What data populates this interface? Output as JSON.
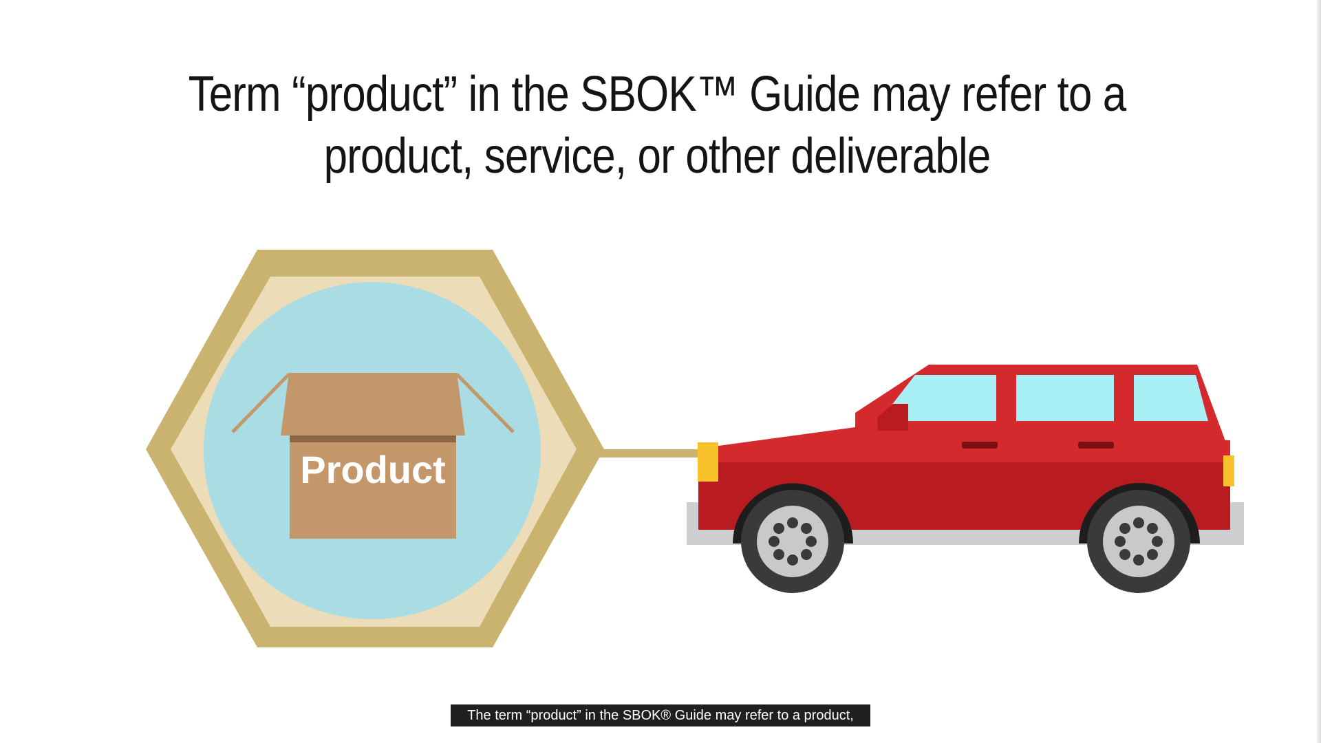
{
  "slide": {
    "title_line_1": "Term “product” in the SBOK™ Guide may refer to a",
    "title_line_2": "product, service, or other deliverable",
    "box_label": "Product"
  },
  "subtitle": {
    "text": "The term “product” in the SBOK® Guide may refer to a product,"
  },
  "colors": {
    "hexagon_outer": "#c9b36f",
    "hexagon_inner": "#ecdcb8",
    "circle": "#a9dce3",
    "box": "#c4976a",
    "car_body": "#d42a2e",
    "car_window": "#a8f0f5",
    "car_light": "#f8c22a",
    "bumper": "#cfcfd1",
    "tire": "#3a3a3a",
    "wheel_rim": "#c9c9c9"
  }
}
